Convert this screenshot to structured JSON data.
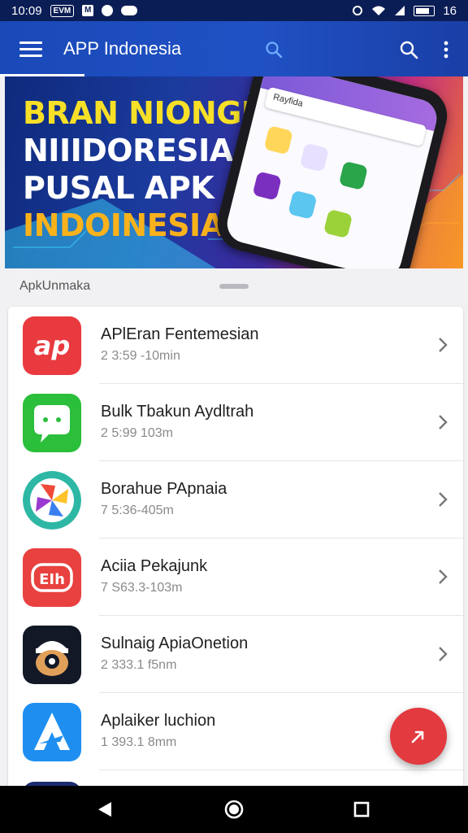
{
  "status_bar": {
    "time": "10:09",
    "chip_label": "EVM",
    "box_label": "M",
    "battery_text": "16"
  },
  "app_bar": {
    "title": "APP Indonesia"
  },
  "banner": {
    "line1": "BRAN NIONGKA",
    "line2": "NIIIDORESIA",
    "line3": "PUSAL APK",
    "line4": "INDOINESIA",
    "phone_search": "Rayfida"
  },
  "section": {
    "label": "ApkUnmaka"
  },
  "apps": [
    {
      "title": "APlEran Fentemesian",
      "subtitle": "2 3:59 -10min",
      "icon": "ap-logo-icon",
      "color": "#e83a3f"
    },
    {
      "title": "Bulk Tbakun Aydltrah",
      "subtitle": "2 5:99 103m",
      "icon": "chat-bubble-icon",
      "color": "#2bbf3b"
    },
    {
      "title": "Borahue PApnaia",
      "subtitle": "7 5:36-405m",
      "icon": "pinwheel-icon",
      "color": "#2fb7a5"
    },
    {
      "title": "Aciia Pekajunk",
      "subtitle": "7 S63.3-103m",
      "icon": "eih-logo-icon",
      "color": "#e8413f"
    },
    {
      "title": "Sulnaig ApiaOnetion",
      "subtitle": "2 333.1 f5nm",
      "icon": "avatar-cap-icon",
      "color": "#121826"
    },
    {
      "title": "Aplaiker luchion",
      "subtitle": "1 393.1 8mm",
      "icon": "a-logo-icon",
      "color": "#1e8ff0"
    }
  ],
  "colors": {
    "app_bar": "#1f4fc1",
    "fab": "#e23a3f",
    "status_bar": "#0b1d55"
  }
}
